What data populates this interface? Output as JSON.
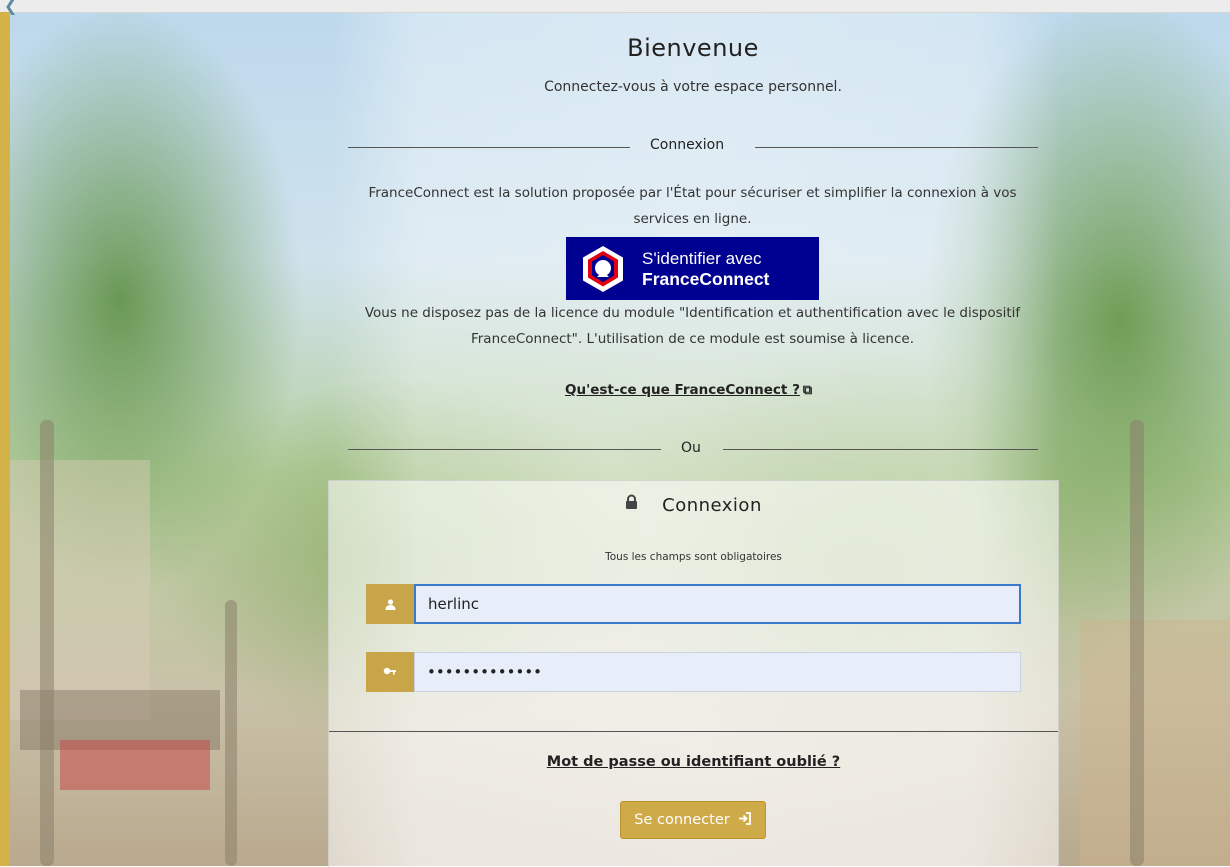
{
  "header": {
    "title": "Bienvenue",
    "subtitle": "Connectez-vous à votre espace personnel."
  },
  "franceconnect": {
    "section_label": "Connexion",
    "description": "FranceConnect est la solution proposée par l'État pour sécuriser et simplifier la connexion à vos services en ligne.",
    "button_line1": "S'identifier avec",
    "button_line2": "FranceConnect",
    "licence_notice": "Vous ne disposez pas de la licence du module \"Identification et authentification avec le dispositif FranceConnect\". L'utilisation de ce module est soumise à licence.",
    "info_link": "Qu'est-ce que FranceConnect ?",
    "brand_color": "#000091"
  },
  "separator": {
    "label": "Ou"
  },
  "login_panel": {
    "title": "Connexion",
    "required_note": "Tous les champs sont obligatoires",
    "username_value": "herlinc",
    "password_value": "•••••••••••••",
    "forgot_link": "Mot de passe ou identifiant oublié ?",
    "submit_label": "Se connecter",
    "accent_color": "#c9a54a",
    "icons": [
      "lock-icon",
      "user-icon",
      "key-icon",
      "sign-in-icon",
      "external-link-icon"
    ]
  }
}
